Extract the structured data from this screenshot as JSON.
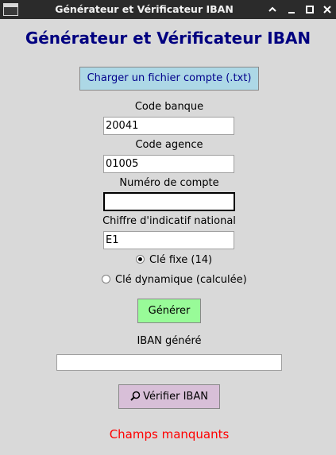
{
  "window": {
    "title": "Générateur et Vérificateur IBAN",
    "minimize_glyph": "–",
    "icons": [
      "app-window-icon",
      "chevron-up-icon",
      "minimize-icon",
      "maximize-icon",
      "close-icon"
    ]
  },
  "heading": "Générateur et Vérificateur IBAN",
  "load_button": "Charger un fichier compte (.txt)",
  "fields": {
    "bank_code": {
      "label": "Code banque",
      "value": "20041"
    },
    "branch_code": {
      "label": "Code agence",
      "value": "01005"
    },
    "account_number": {
      "label": "Numéro de compte",
      "value": ""
    },
    "national_check": {
      "label": "Chiffre d'indicatif national",
      "value": "E1"
    }
  },
  "key_options": {
    "fixed": {
      "label": "Clé fixe (14)",
      "selected": true
    },
    "dynamic": {
      "label": "Clé dynamique (calculée)",
      "selected": false
    }
  },
  "generate_button": "Générer",
  "iban": {
    "label": "IBAN généré",
    "value": ""
  },
  "verify_button": {
    "label": "Vérifier IBAN",
    "icon": "magnifier-icon"
  },
  "status": {
    "text": "Champs manquants",
    "color": "#ff0000"
  },
  "colors": {
    "heading": "#000080",
    "load_button_bg": "#add8e6",
    "generate_button_bg": "#98fb98",
    "verify_button_bg": "#d8bfd8",
    "window_bg": "#d9d9d9"
  }
}
